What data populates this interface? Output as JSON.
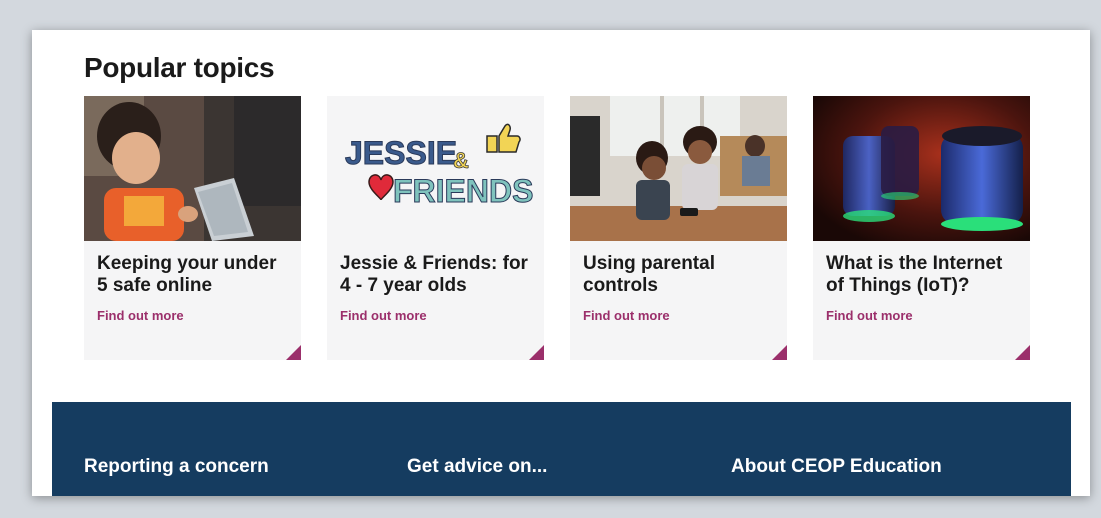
{
  "section": {
    "title": "Popular topics"
  },
  "cards": [
    {
      "title": "Keeping your under 5 safe online",
      "link": "Find out more",
      "image": "child-with-tablet"
    },
    {
      "title": "Jessie & Friends: for 4 - 7 year olds",
      "link": "Find out more",
      "image": "jessie-and-friends-logo",
      "logo": {
        "line1": "JESSIE",
        "amp": "&",
        "line2": "FRIENDS"
      }
    },
    {
      "title": "Using parental controls",
      "link": "Find out more",
      "image": "children-using-phone"
    },
    {
      "title": "What is the Internet of Things (IoT)?",
      "link": "Find out more",
      "image": "smart-speakers"
    }
  ],
  "footer": {
    "links": [
      "Reporting a concern",
      "Get advice on...",
      "About CEOP Education"
    ]
  },
  "colors": {
    "accent": "#9b2f6b",
    "footer_bg": "#153c60",
    "card_bg": "#f5f5f6"
  }
}
